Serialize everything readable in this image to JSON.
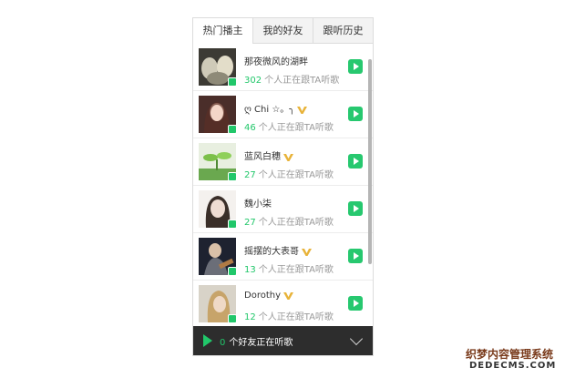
{
  "tabs": [
    {
      "label": "热门播主",
      "active": true
    },
    {
      "label": "我的好友",
      "active": false
    },
    {
      "label": "跟听历史",
      "active": false
    }
  ],
  "listen_suffix": "个人正在跟TA听歌",
  "items": [
    {
      "name": "那夜微风的湖畔",
      "count": "302",
      "vip": false
    },
    {
      "name": "ღ Chi ☆。╮",
      "count": "46",
      "vip": true
    },
    {
      "name": "蓝风白穗",
      "count": "27",
      "vip": true
    },
    {
      "name": "魏小柒",
      "count": "27",
      "vip": false
    },
    {
      "name": "摇摆的大表哥",
      "count": "13",
      "vip": true
    },
    {
      "name": "Dorothy",
      "count": "12",
      "vip": true
    }
  ],
  "footer": {
    "count": "0",
    "text": "个好友正在听歌"
  },
  "watermark": {
    "line1": "织梦内容管理系统",
    "line2": "DEDECMS.COM"
  },
  "colors": {
    "accent": "#21c76a",
    "footer_bg": "#2d2d2d",
    "vip": "#e8b33a"
  },
  "icons": {
    "play": "play-icon",
    "vip": "vip-badge-icon",
    "chevron": "chevron-down-icon"
  }
}
